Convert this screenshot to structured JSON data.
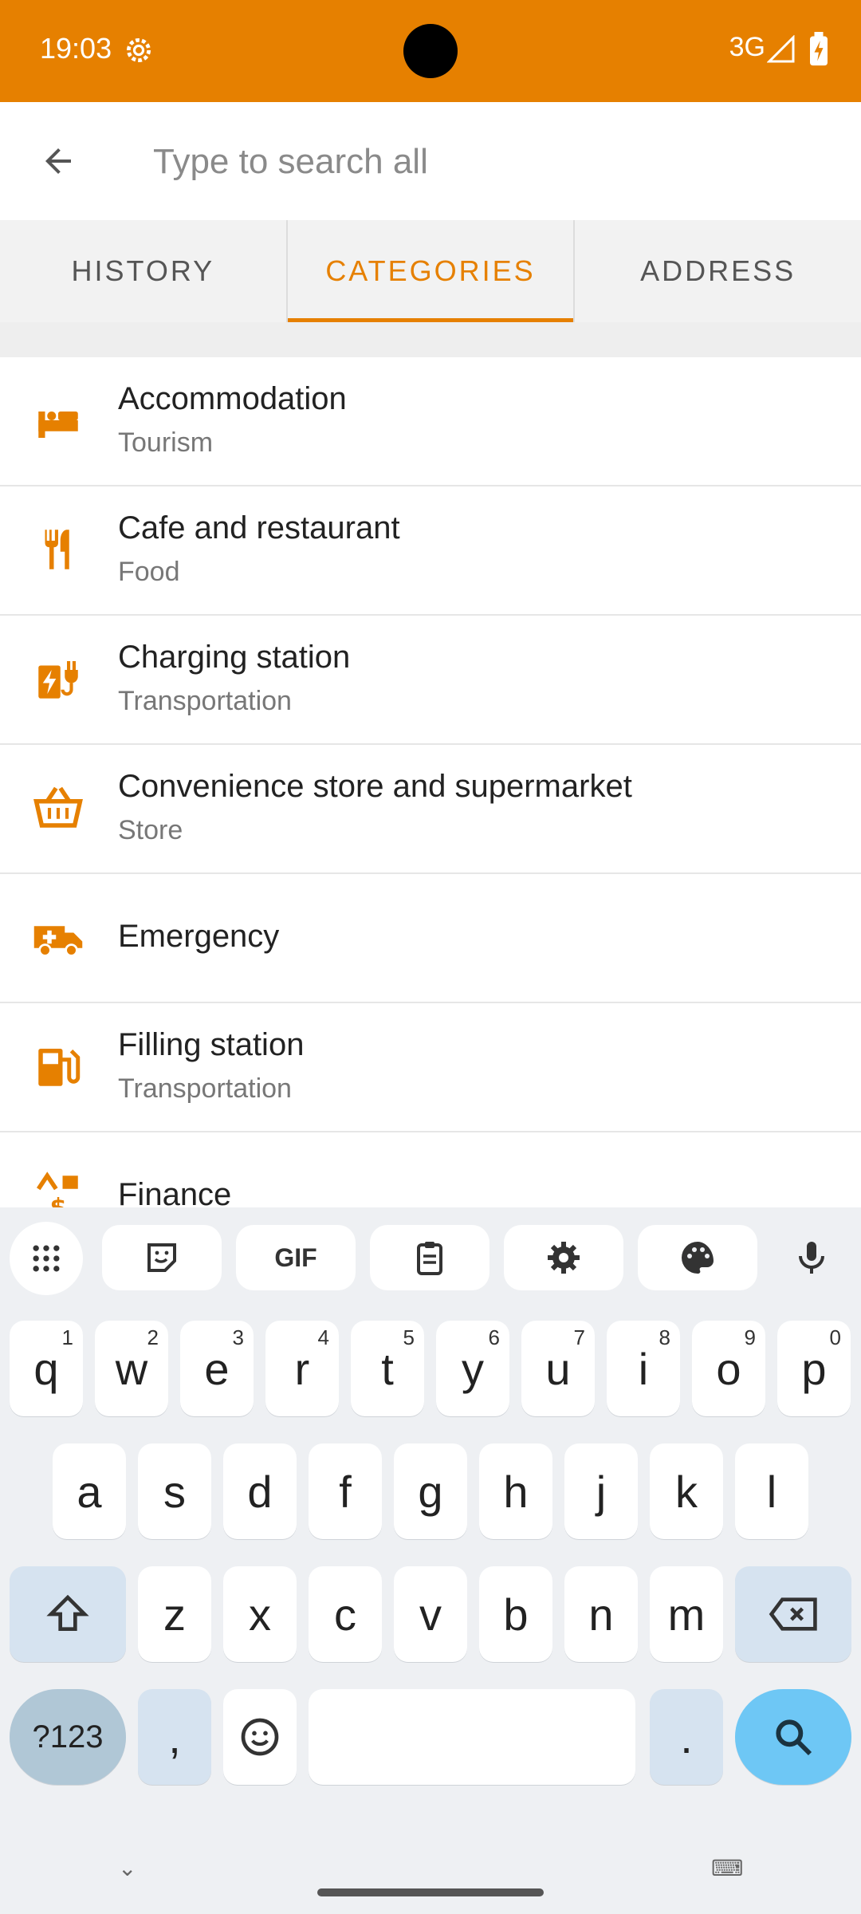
{
  "status": {
    "time": "19:03",
    "network": "3G"
  },
  "search": {
    "placeholder": "Type to search all",
    "value": ""
  },
  "tabs": [
    {
      "label": "HISTORY",
      "active": false
    },
    {
      "label": "CATEGORIES",
      "active": true
    },
    {
      "label": "ADDRESS",
      "active": false
    }
  ],
  "categories": [
    {
      "title": "Accommodation",
      "subtitle": "Tourism",
      "icon": "bed-icon"
    },
    {
      "title": "Cafe and restaurant",
      "subtitle": "Food",
      "icon": "fork-knife-icon"
    },
    {
      "title": "Charging station",
      "subtitle": "Transportation",
      "icon": "charging-plug-icon"
    },
    {
      "title": "Convenience store and supermarket",
      "subtitle": "Store",
      "icon": "shopping-basket-icon"
    },
    {
      "title": "Emergency",
      "subtitle": "",
      "icon": "ambulance-icon"
    },
    {
      "title": "Filling station",
      "subtitle": "Transportation",
      "icon": "fuel-pump-icon"
    },
    {
      "title": "Finance",
      "subtitle": "",
      "icon": "currency-icon"
    }
  ],
  "keyboard": {
    "toolbar": [
      "apps-grid-icon",
      "sticker-icon",
      "GIF",
      "clipboard-icon",
      "settings-icon",
      "palette-icon",
      "microphone-icon"
    ],
    "row1": [
      [
        "q",
        "1"
      ],
      [
        "w",
        "2"
      ],
      [
        "e",
        "3"
      ],
      [
        "r",
        "4"
      ],
      [
        "t",
        "5"
      ],
      [
        "y",
        "6"
      ],
      [
        "u",
        "7"
      ],
      [
        "i",
        "8"
      ],
      [
        "o",
        "9"
      ],
      [
        "p",
        "0"
      ]
    ],
    "row2": [
      "a",
      "s",
      "d",
      "f",
      "g",
      "h",
      "j",
      "k",
      "l"
    ],
    "row3": [
      "z",
      "x",
      "c",
      "v",
      "b",
      "n",
      "m"
    ],
    "mode_label": "?123",
    "comma": ",",
    "period": "."
  },
  "colors": {
    "accent": "#E68000",
    "status_bar": "#E68000"
  }
}
